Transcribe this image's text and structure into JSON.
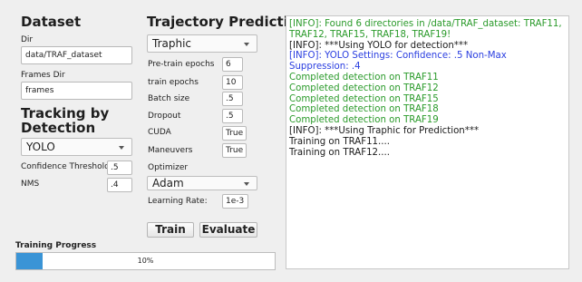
{
  "dataset": {
    "heading": "Dataset",
    "dir_label": "Dir",
    "dir_value": "data/TRAF_dataset",
    "frames_label": "Frames Dir",
    "frames_value": "frames"
  },
  "tracking": {
    "heading": "Tracking by Detection",
    "detector": "YOLO",
    "conf_label": "Confidence Threshold",
    "conf_value": ".5",
    "nms_label": "NMS",
    "nms_value": ".4"
  },
  "trajectory": {
    "heading": "Trajectory Prediction",
    "model": "Traphic",
    "pretrain_label": "Pre-train epochs",
    "pretrain_value": "6",
    "train_label": "train epochs",
    "train_value": "10",
    "batch_label": "Batch size",
    "batch_value": ".5",
    "dropout_label": "Dropout",
    "dropout_value": ".5",
    "cuda_label": "CUDA",
    "cuda_value": "True",
    "maneuvers_label": "Maneuvers",
    "maneuvers_value": "True",
    "optimizer_label": "Optimizer",
    "optimizer_value": "Adam",
    "lr_label": "Learning Rate:",
    "lr_value": "1e-3",
    "train_button": "Train",
    "evaluate_button": "Evaluate"
  },
  "progress": {
    "label": "Training Progress",
    "percent": 10,
    "text": "10%",
    "color": "#3a94d6"
  },
  "console": {
    "colors": {
      "green": "#2a9a2a",
      "blue": "#2a3ee0",
      "black": "#1b1b1b"
    },
    "lines": [
      {
        "text": "[INFO]: Found 6 directories in /data/TRAF_dataset: TRAF11, TRAF12, TRAF15, TRAF18, TRAF19!",
        "color": "green"
      },
      {
        "text": "[INFO]: ***Using YOLO for detection***",
        "color": "black"
      },
      {
        "text": "[INFO]: YOLO Settings: Confidence: .5 Non-Max Suppression: .4",
        "color": "blue"
      },
      {
        "text": "Completed detection on TRAF11",
        "color": "green"
      },
      {
        "text": "Completed detection on TRAF12",
        "color": "green"
      },
      {
        "text": "Completed detection on TRAF15",
        "color": "green"
      },
      {
        "text": "Completed detection on TRAF18",
        "color": "green"
      },
      {
        "text": "Completed detection on TRAF19",
        "color": "green"
      },
      {
        "text": "[INFO]: ***Using Traphic for Prediction***",
        "color": "black"
      },
      {
        "text": "Training on TRAF11....",
        "color": "black"
      },
      {
        "text": "Training on TRAF12....",
        "color": "black"
      }
    ]
  }
}
